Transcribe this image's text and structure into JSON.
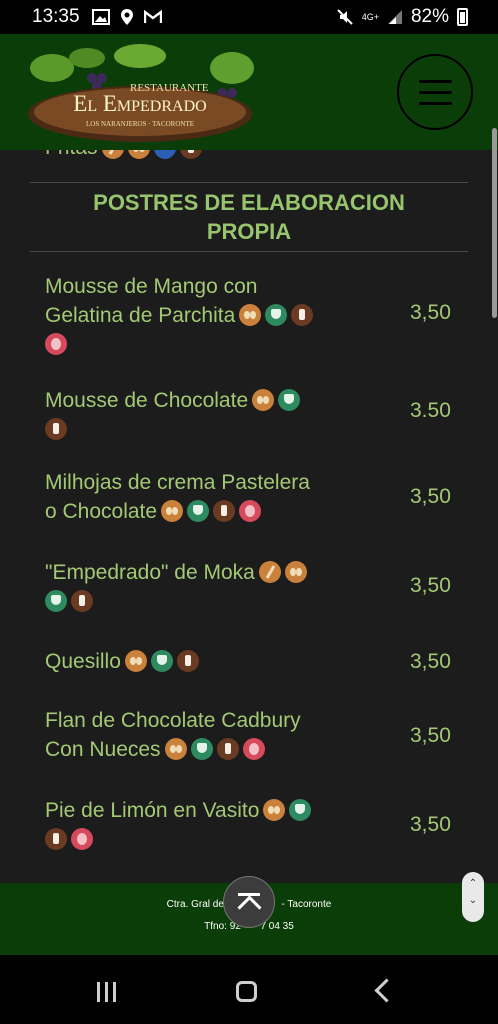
{
  "status_bar": {
    "time": "13:35",
    "network": "4G+",
    "battery": "82%"
  },
  "header": {
    "logo_top": "Restaurante",
    "logo_name": "El Empedrado",
    "logo_sub": "LOS NARANJEROS · TACORONTE",
    "menu_icon": "hamburger-menu-icon"
  },
  "previous_item": {
    "label": "Fritas"
  },
  "section": {
    "title_line1": "POSTRES DE ELABORACION",
    "title_line2": "PROPIA"
  },
  "items": [
    {
      "line1": "Mousse de Mango con",
      "line2": "Gelatina de Parchita",
      "price": "3,50"
    },
    {
      "line1": "Mousse de Chocolate",
      "line2": "",
      "price": "3.50"
    },
    {
      "line1": "Milhojas de crema Pastelera",
      "line2": "o Chocolate",
      "price": "3,50"
    },
    {
      "line1": "\"Empedrado\" de Moka",
      "line2": "",
      "price": "3,50"
    },
    {
      "line1": "Quesillo",
      "line2": "",
      "price": "3,50"
    },
    {
      "line1": "Flan de Chocolate Cadbury",
      "line2": "Con Nueces",
      "price": "3,50"
    },
    {
      "line1": "Pie de Limón en Vasito",
      "line2": "",
      "price": "3,50"
    }
  ],
  "footer": {
    "address_left": "Ctra. Gral de",
    "address_right": "- Tacoronte",
    "phone_left": "Tfno: 92",
    "phone_right": "7 04 35"
  },
  "colors": {
    "header_bg": "#0a3d07",
    "text_green": "#a3c974",
    "title_green": "#97c56d",
    "page_bg": "#1c1c1c"
  }
}
